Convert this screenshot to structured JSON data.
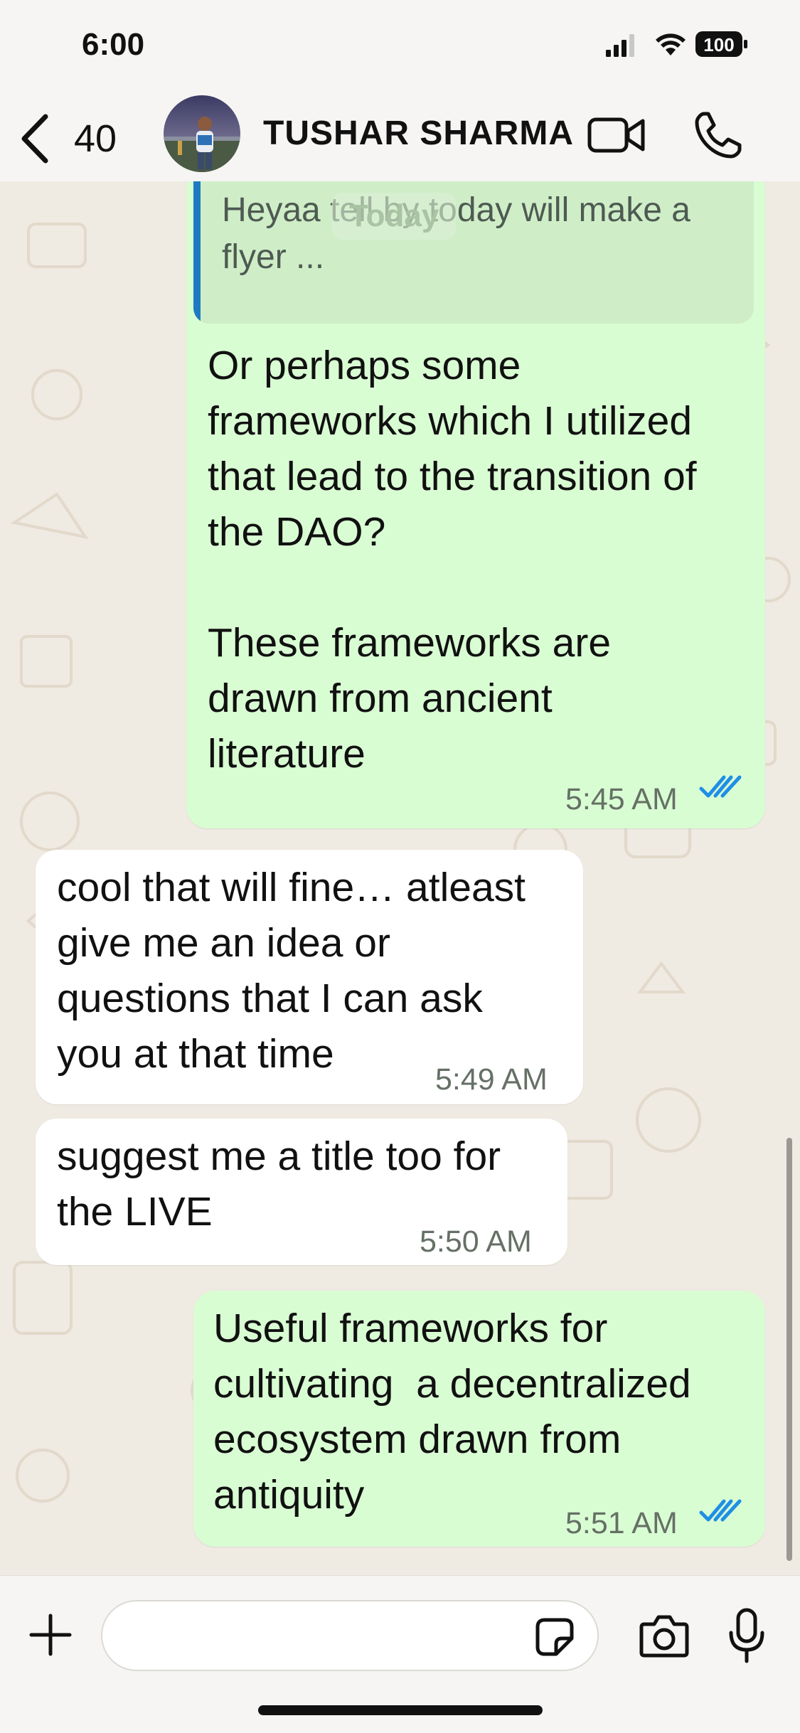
{
  "status_bar": {
    "time": "6:00",
    "battery": "100"
  },
  "header": {
    "back_count": "40",
    "contact_name": "TUSHAR SHARMA"
  },
  "chat": {
    "date_label": "Today",
    "messages": [
      {
        "direction": "outgoing",
        "quoted_text": "Heyaa tell by today will make a\nflyer ...",
        "text": "Or perhaps some\nframeworks which I utilized\nthat lead to the transition of\nthe DAO?\n\nThese frameworks are\ndrawn from ancient\nliterature",
        "time": "5:45 AM",
        "status": "read"
      },
      {
        "direction": "incoming",
        "text": "cool that will fine… atleast\ngive me an idea or\nquestions that I can ask\nyou at that time",
        "time": "5:49 AM"
      },
      {
        "direction": "incoming",
        "text": "suggest me a title too for\nthe LIVE",
        "time": "5:50 AM"
      },
      {
        "direction": "outgoing",
        "text": "Useful frameworks for\ncultivating  a decentralized\necosystem drawn from\nantiquity",
        "time": "5:51 AM",
        "status": "read"
      }
    ]
  },
  "input_bar": {
    "message_value": "",
    "message_placeholder": ""
  },
  "colors": {
    "outgoing_bubble": "#d9fdd3",
    "incoming_bubble": "#ffffff",
    "read_ticks": "#1f8fe6",
    "quote_bar": "#1f7bc1",
    "wallpaper": "#efeae2"
  }
}
